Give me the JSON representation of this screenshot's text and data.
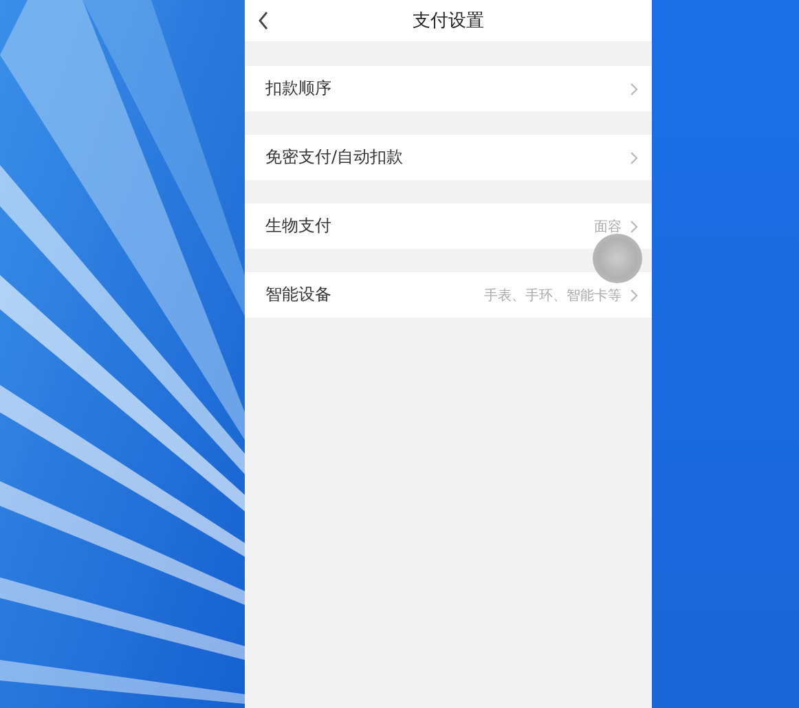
{
  "header": {
    "title": "支付设置"
  },
  "rows": [
    {
      "label": "扣款顺序"
    },
    {
      "label": "免密支付/自动扣款"
    },
    {
      "label": "生物支付",
      "value": "面容"
    },
    {
      "label": "智能设备",
      "value": "手表、手环、智能卡等"
    }
  ]
}
